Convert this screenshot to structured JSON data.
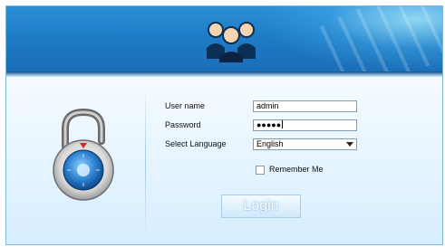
{
  "banner": {
    "icon": "users-icon"
  },
  "lock": {
    "icon": "padlock-icon"
  },
  "form": {
    "username": {
      "label": "User name",
      "value": "admin"
    },
    "password": {
      "label": "Password",
      "value": "●●●●●"
    },
    "language": {
      "label": "Select Language",
      "value": "English"
    },
    "remember": {
      "label": "Remember Me",
      "checked": false
    },
    "login_button": "Login"
  },
  "colors": {
    "banner_blue": "#1f7cc6",
    "panel_light": "#e8f5ff"
  }
}
